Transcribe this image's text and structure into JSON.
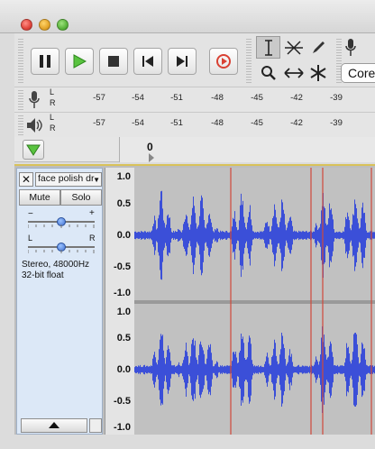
{
  "meter_scale": [
    "-57",
    "-54",
    "-51",
    "-48",
    "-45",
    "-42",
    "-39"
  ],
  "channel_labels": {
    "left": "L",
    "right": "R"
  },
  "toolbar": {
    "pause": "pause-icon",
    "play": "play-icon",
    "stop": "stop-icon",
    "skip_start": "skip-start-icon",
    "skip_end": "skip-end-icon",
    "record": "record-icon",
    "device_label": "Core"
  },
  "timeline": {
    "zero_label": "0"
  },
  "track": {
    "name": "face polish dr",
    "mute_label": "Mute",
    "solo_label": "Solo",
    "gain_minus": "−",
    "gain_plus": "+",
    "pan_left": "L",
    "pan_right": "R",
    "gain_level": 0.5,
    "pan_level": 0.5,
    "info_line1": "Stereo, 48000Hz",
    "info_line2": "32-bit float"
  },
  "vertical_scale": {
    "top_channel": [
      "1.0",
      "0.5",
      "0.0",
      "-0.5",
      "-1.0"
    ],
    "bottom_channel": [
      "1.0",
      "0.5",
      "0.0",
      "-0.5",
      "-1.0"
    ]
  },
  "colors": {
    "waveform": "#3b4fd8",
    "waveform_bg": "#c1c1c1",
    "clip_boundary": "#d0493a",
    "track_panel": "#dce8f7",
    "selected_border": "#d8c25a"
  }
}
